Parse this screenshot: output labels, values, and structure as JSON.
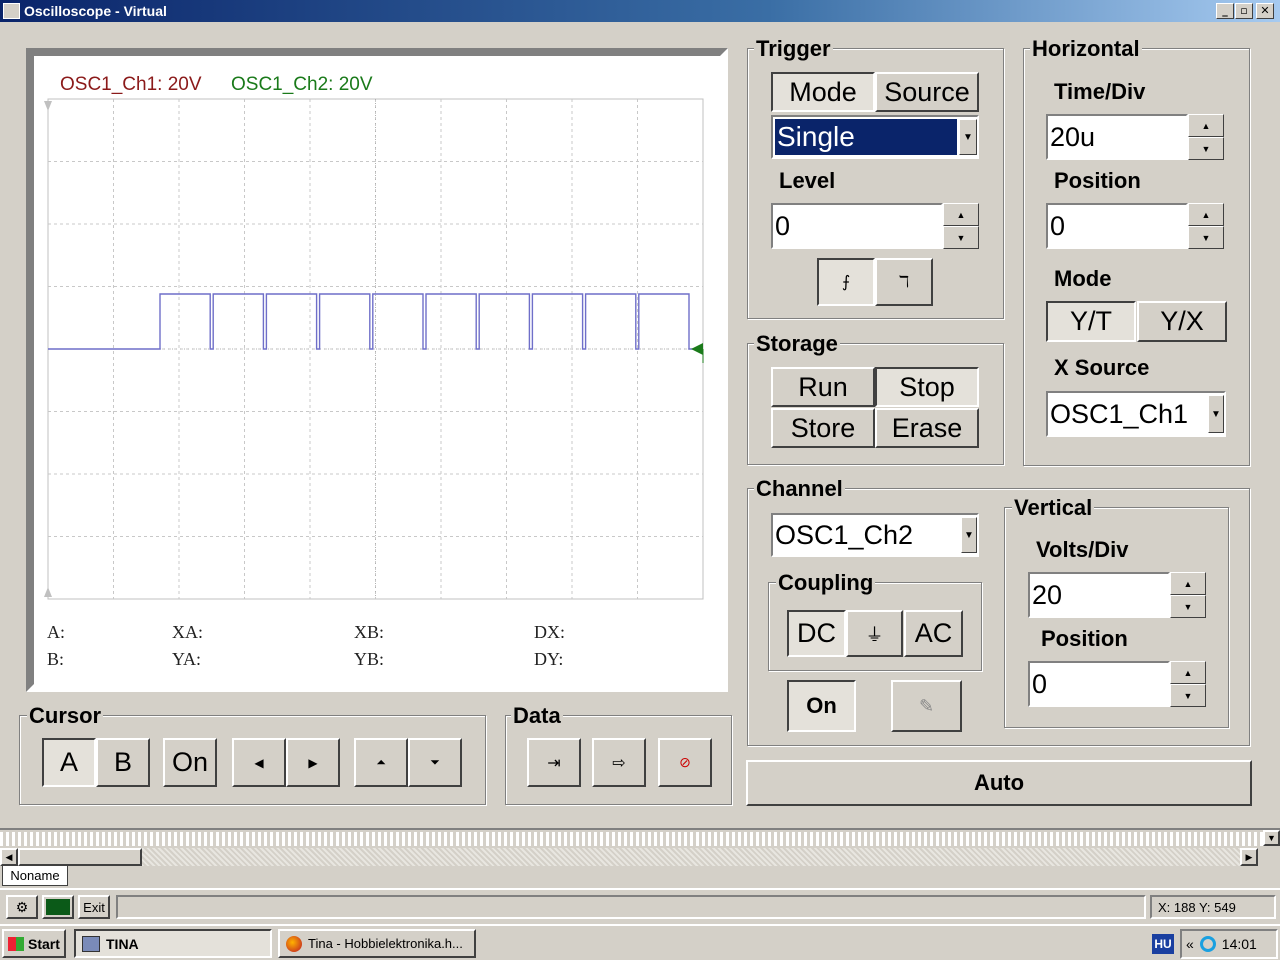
{
  "window": {
    "title": "Oscilloscope - Virtual"
  },
  "screen": {
    "ch1_label": "OSC1_Ch1: 20V",
    "ch2_label": "OSC1_Ch2: 20V",
    "ch1_color": "#8b1a1a",
    "ch2_color": "#1a7a1a",
    "trace_color": "#6f6fc9",
    "cursor_labels": {
      "a": "A:",
      "xa": "XA:",
      "xb": "XB:",
      "dx": "DX:",
      "b": "B:",
      "ya": "YA:",
      "yb": "YB:",
      "dy": "DY:"
    }
  },
  "trigger": {
    "title": "Trigger",
    "mode_btn": "Mode",
    "source_btn": "Source",
    "mode_value": "Single",
    "level_label": "Level",
    "level_value": "0"
  },
  "storage": {
    "title": "Storage",
    "run": "Run",
    "stop": "Stop",
    "store": "Store",
    "erase": "Erase"
  },
  "horizontal": {
    "title": "Horizontal",
    "timediv_label": "Time/Div",
    "timediv_value": "20u",
    "position_label": "Position",
    "position_value": "0",
    "mode_label": "Mode",
    "yt": "Y/T",
    "yx": "Y/X",
    "xsource_label": "X Source",
    "xsource_value": "OSC1_Ch1"
  },
  "channel": {
    "title": "Channel",
    "value": "OSC1_Ch2",
    "coupling_title": "Coupling",
    "dc": "DC",
    "ground": "⏚",
    "ac": "AC",
    "on": "On"
  },
  "vertical": {
    "title": "Vertical",
    "voltsdiv_label": "Volts/Div",
    "voltsdiv_value": "20",
    "position_label": "Position",
    "position_value": "0"
  },
  "cursor": {
    "title": "Cursor",
    "a": "A",
    "b": "B",
    "on": "On"
  },
  "data": {
    "title": "Data"
  },
  "auto": "Auto",
  "document_tab": "Noname",
  "toolbar": {
    "exit": "Exit",
    "coords": "X: 188  Y: 549"
  },
  "taskbar": {
    "start": "Start",
    "task1": "TINA",
    "task2": "Tina - Hobbielektronika.h...",
    "lang": "HU",
    "chevron": "«",
    "clock": "14:01"
  }
}
